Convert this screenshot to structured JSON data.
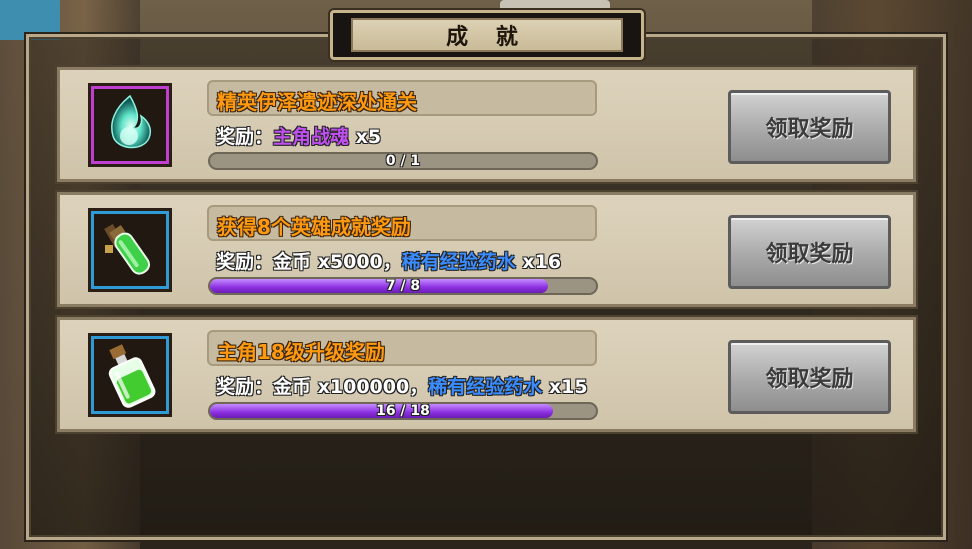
{
  "title": "成 就",
  "colors": {
    "title_orange": "#ff9a10",
    "purple_fill": "#8c2fe0",
    "blue_text": "#3a8cff",
    "purple_text": "#c04ff0"
  },
  "achievements": [
    {
      "title": "精英伊泽遗迹深处通关",
      "reward_prefix": "奖励：",
      "reward_plain": "",
      "reward_highlight": "主角战魂",
      "reward_highlight_color": "purple",
      "reward_suffix": " x5",
      "progress_text": "0 / 1",
      "progress_value": 0.0,
      "button_label": "领取奖励",
      "icon": "soul-flame-icon"
    },
    {
      "title": "获得8个英雄成就奖励",
      "reward_prefix": "奖励：",
      "reward_plain": "金币 x5000，",
      "reward_highlight": "稀有经验药水",
      "reward_highlight_color": "blue",
      "reward_suffix": " x16",
      "progress_text": "7 / 8",
      "progress_value": 0.875,
      "button_label": "领取奖励",
      "icon": "potion-vial-icon"
    },
    {
      "title": "主角18级升级奖励",
      "reward_prefix": "奖励：",
      "reward_plain": "金币 x100000，",
      "reward_highlight": "稀有经验药水",
      "reward_highlight_color": "blue",
      "reward_suffix": " x15",
      "progress_text": "16 / 18",
      "progress_value": 0.889,
      "button_label": "领取奖励",
      "icon": "potion-bottle-icon"
    }
  ]
}
